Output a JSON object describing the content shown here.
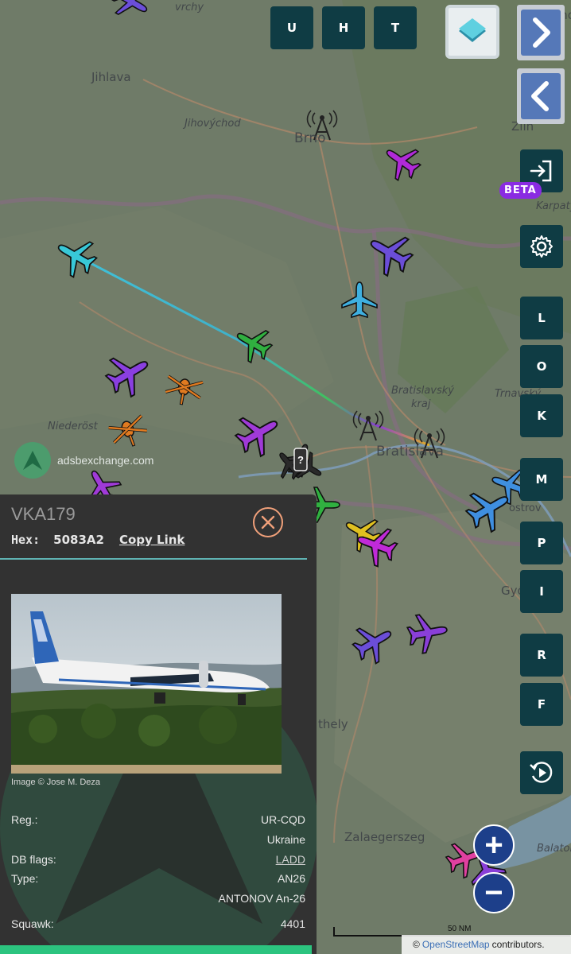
{
  "top_buttons": [
    "U",
    "H",
    "T"
  ],
  "badge": "BETA",
  "side_buttons": [
    "L",
    "O",
    "K",
    "M",
    "P",
    "I",
    "R",
    "F"
  ],
  "logo_text": "adsbexchange.com",
  "map_labels": {
    "vrchy": "vrchy",
    "olomouc": "Olomo",
    "jihlava": "Jihlava",
    "jihovychod": "Jihovýchod",
    "brno": "Brno",
    "zlin": "Zlín",
    "karpaty": "Karpaty",
    "bratislavsky": "Bratislavský",
    "kraj": "kraj",
    "trnavsky": "Trnavský",
    "bratislava": "Bratislava",
    "niederost": "Niederöst",
    "ostrov": "ostrov",
    "gyo": "Győ",
    "thely": "thely",
    "zalaegerszeg": "Zalaegerszeg",
    "balaton": "Balaton"
  },
  "scale_label": "50 NM",
  "attribution": {
    "prefix": "©",
    "link": "OpenStreetMap",
    "suffix": "contributors."
  },
  "zoom": {
    "in": "+",
    "out": "−"
  },
  "panel": {
    "callsign": "VKA179",
    "hex_label": "Hex:",
    "hex_value": "5083A2",
    "copy_link": "Copy Link",
    "image_credit": "Image © Jose M. Deza",
    "rows": {
      "reg_label": "Reg.:",
      "reg_value": "UR-CQD",
      "country": "Ukraine",
      "db_flags_label": "DB flags:",
      "db_flags_value": "LADD",
      "type_label": "Type:",
      "type_value": "AN26",
      "type_name": "ANTONOV An-26",
      "squawk_label": "Squawk:",
      "squawk_value": "4401"
    }
  },
  "colors": {
    "map_bg": "#6e7a66",
    "button_bg": "#0f3c44",
    "panel_bg": "#323232",
    "accent_teal": "#5fb3b3",
    "beta_purple": "#8a2be2"
  }
}
